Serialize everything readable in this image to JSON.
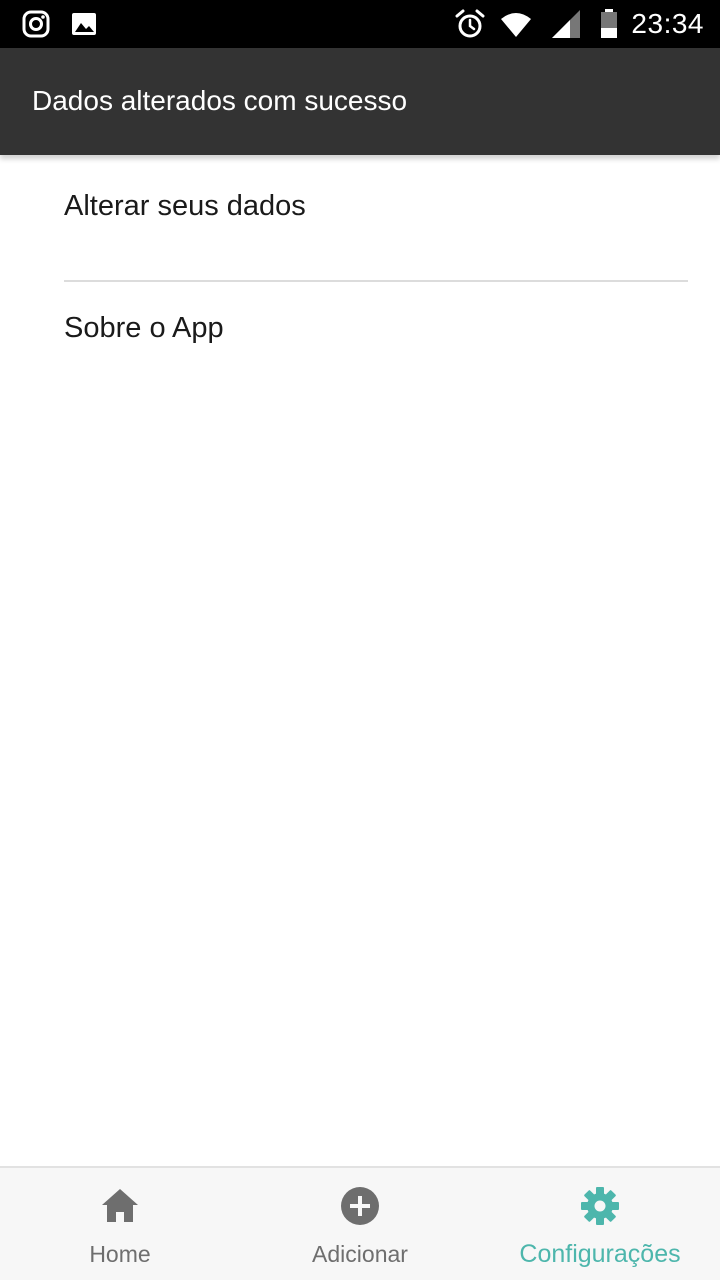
{
  "status_bar": {
    "time": "23:34",
    "left_icons": [
      "instagram-icon",
      "image-icon"
    ],
    "right_icons": [
      "alarm-icon",
      "wifi-icon",
      "signal-icon",
      "battery-icon"
    ]
  },
  "toast": {
    "message": "Dados alterados com sucesso"
  },
  "menu": {
    "items": [
      {
        "label": "Alterar seus dados"
      },
      {
        "label": "Sobre o App"
      }
    ]
  },
  "tab_bar": {
    "tabs": [
      {
        "label": "Home",
        "icon": "home-icon",
        "active": false
      },
      {
        "label": "Adicionar",
        "icon": "add-circle-icon",
        "active": false
      },
      {
        "label": "Configurações",
        "icon": "gear-icon",
        "active": true
      }
    ]
  },
  "colors": {
    "status_bar_bg": "#000000",
    "toast_bg": "#333333",
    "tab_inactive": "#6e6e6e",
    "tab_active": "#4db6ac",
    "tab_bar_bg": "#f7f7f7",
    "divider": "#dcdcdc"
  }
}
